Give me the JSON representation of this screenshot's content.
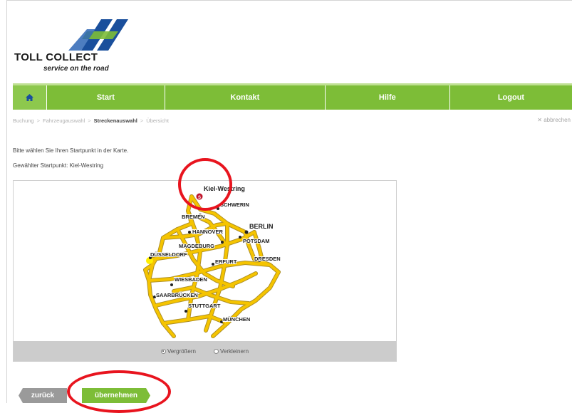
{
  "brand": {
    "name": "TOLL COLLECT",
    "tagline": "service on the road"
  },
  "nav": {
    "home_icon": "home-icon",
    "items": [
      {
        "label": "Start"
      },
      {
        "label": "Kontakt"
      },
      {
        "label": "Hilfe"
      },
      {
        "label": "Logout"
      }
    ]
  },
  "breadcrumb": {
    "steps": [
      {
        "label": "Buchung",
        "active": false
      },
      {
        "label": "Fahrzeugauswahl",
        "active": false
      },
      {
        "label": "Streckenauswahl",
        "active": true
      },
      {
        "label": "Übersicht",
        "active": false
      }
    ],
    "separator": ">"
  },
  "cancel_label": "✕ abbrechen",
  "instruction": "Bitte wählen Sie Ihren Startpunkt in der Karte.",
  "selected_point": "Gewählter Startpunkt: Kiel-Westring",
  "map": {
    "cities": [
      {
        "name": "Kiel-Westring",
        "primary": true
      },
      {
        "name": "SCHWERIN"
      },
      {
        "name": "BREMEN"
      },
      {
        "name": "BERLIN",
        "capital": true
      },
      {
        "name": "HANNOVER"
      },
      {
        "name": "POTSDAM"
      },
      {
        "name": "MAGDEBURG"
      },
      {
        "name": "DÜSSELDORF"
      },
      {
        "name": "DRESDEN"
      },
      {
        "name": "ERFURT"
      },
      {
        "name": "WIESBADEN"
      },
      {
        "name": "SAARBRÜCKEN"
      },
      {
        "name": "STUTTGART"
      },
      {
        "name": "MÜNCHEN"
      }
    ],
    "zoom_options": [
      {
        "label": "Vergrößern",
        "checked": true
      },
      {
        "label": "Verkleinern",
        "checked": false
      }
    ],
    "road_color": "#f5c400",
    "marker_color": "#c0162c"
  },
  "buttons": {
    "back": "zurück",
    "accept": "übernehmen"
  },
  "colors": {
    "accent_green": "#7dbd37",
    "highlight_red": "#e8141e",
    "back_gray": "#9a9a9a"
  }
}
